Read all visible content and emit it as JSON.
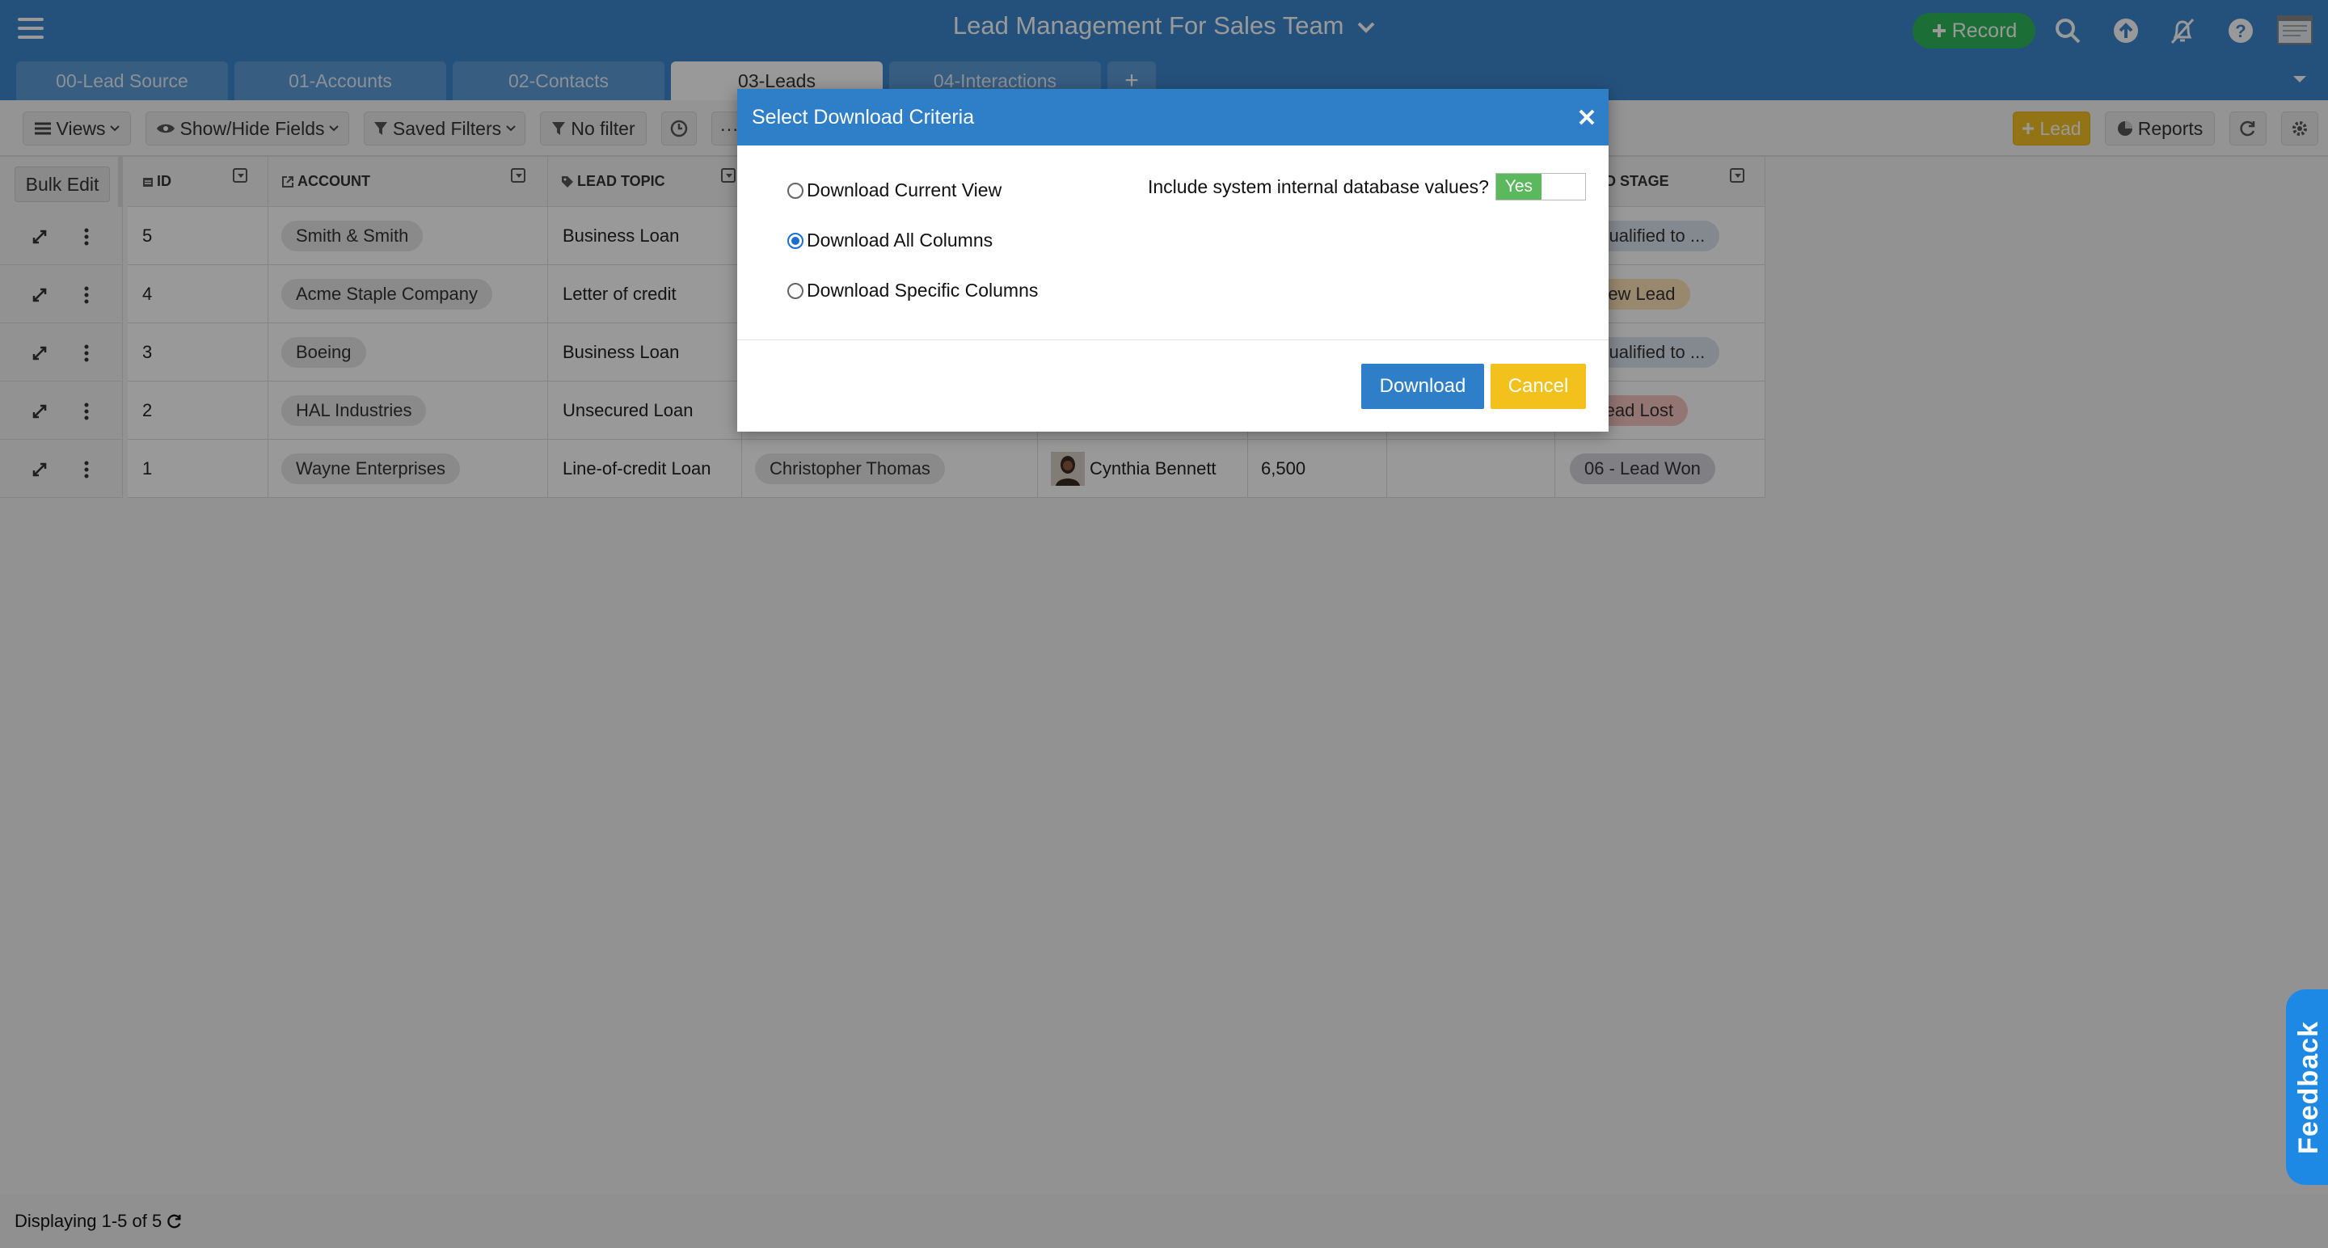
{
  "app": {
    "title": "Lead Management For Sales Team",
    "record_label": "Record"
  },
  "tabs": [
    {
      "label": "00-Lead Source"
    },
    {
      "label": "01-Accounts"
    },
    {
      "label": "02-Contacts"
    },
    {
      "label": "03-Leads"
    },
    {
      "label": "04-Interactions"
    }
  ],
  "toolbar": {
    "views": "Views",
    "show_hide": "Show/Hide Fields",
    "saved_filters": "Saved Filters",
    "no_filter": "No filter",
    "lead": "Lead",
    "reports": "Reports"
  },
  "table": {
    "bulk_edit": "Bulk Edit",
    "headers": {
      "id": "ID",
      "account": "ACCOUNT",
      "lead_topic": "LEAD TOPIC",
      "stage": "D STAGE"
    },
    "rows": [
      {
        "id": "5",
        "account": "Smith & Smith",
        "topic": "Business Loan",
        "contact": "",
        "owner": "",
        "amount": "",
        "stage": "- Qualified to ..."
      },
      {
        "id": "4",
        "account": "Acme Staple Company",
        "topic": "Letter of credit",
        "contact": "",
        "owner": "",
        "amount": "",
        "stage": "- New Lead"
      },
      {
        "id": "3",
        "account": "Boeing",
        "topic": "Business Loan",
        "contact": "",
        "owner": "",
        "amount": "",
        "stage": "- Qualified to ..."
      },
      {
        "id": "2",
        "account": "HAL Industries",
        "topic": "Unsecured Loan",
        "contact": "",
        "owner": "",
        "amount": "",
        "stage": "- Lead Lost"
      },
      {
        "id": "1",
        "account": "Wayne Enterprises",
        "topic": "Line-of-credit Loan",
        "contact": "Christopher Thomas",
        "owner": "Cynthia Bennett",
        "amount": "6,500",
        "stage": "06 - Lead Won"
      }
    ]
  },
  "footer": {
    "displaying": "Displaying 1-5 of 5"
  },
  "feedback": "Feedback",
  "modal": {
    "title": "Select Download Criteria",
    "options": [
      "Download Current View",
      "Download All Columns",
      "Download Specific Columns"
    ],
    "selected": "Download All Columns",
    "include_label": "Include system internal database values?",
    "toggle_on": "Yes",
    "download": "Download",
    "cancel": "Cancel"
  },
  "colors": {
    "header_blue": "#3d87cf",
    "record_green": "#2fb75d",
    "lead_yellow": "#f4c225",
    "feedback_blue": "#1e88e5"
  }
}
